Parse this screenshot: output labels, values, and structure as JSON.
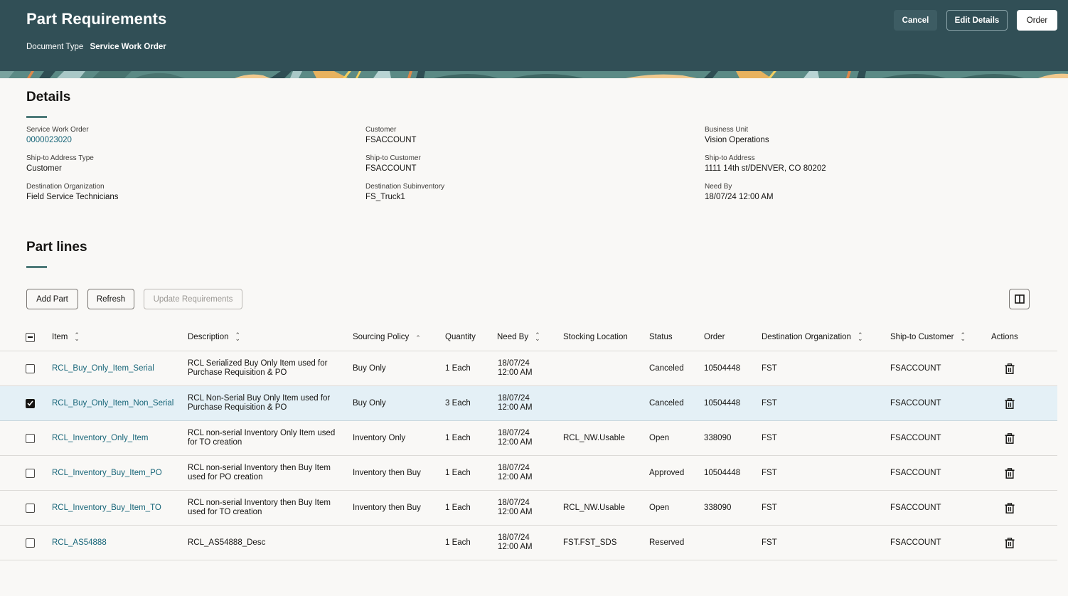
{
  "header": {
    "title": "Part Requirements",
    "document_type_label": "Document Type",
    "document_type_value": "Service Work Order",
    "buttons": {
      "cancel": "Cancel",
      "edit_details": "Edit Details",
      "order": "Order"
    }
  },
  "details": {
    "title": "Details",
    "fields": {
      "service_work_order": {
        "label": "Service Work Order",
        "value": "0000023020"
      },
      "customer": {
        "label": "Customer",
        "value": "FSACCOUNT"
      },
      "business_unit": {
        "label": "Business Unit",
        "value": "Vision Operations"
      },
      "ship_to_address_type": {
        "label": "Ship-to Address Type",
        "value": "Customer"
      },
      "ship_to_customer": {
        "label": "Ship-to Customer",
        "value": "FSACCOUNT"
      },
      "ship_to_address": {
        "label": "Ship-to Address",
        "value": "1111 14th st/DENVER, CO 80202"
      },
      "destination_organization": {
        "label": "Destination Organization",
        "value": "Field Service Technicians"
      },
      "destination_subinventory": {
        "label": "Destination Subinventory",
        "value": "FS_Truck1"
      },
      "need_by": {
        "label": "Need By",
        "value": "18/07/24 12:00 AM"
      }
    }
  },
  "part_lines": {
    "title": "Part lines",
    "toolbar": {
      "add_part": "Add Part",
      "refresh": "Refresh",
      "update_requirements": "Update Requirements"
    },
    "columns": {
      "item": "Item",
      "description": "Description",
      "sourcing_policy": "Sourcing Policy",
      "quantity": "Quantity",
      "need_by": "Need By",
      "stocking_location": "Stocking Location",
      "status": "Status",
      "order": "Order",
      "destination_organization": "Destination Organization",
      "ship_to_customer": "Ship-to Customer",
      "actions": "Actions"
    },
    "rows": [
      {
        "checked": false,
        "item": "RCL_Buy_Only_Item_Serial",
        "description_1": "RCL Serialized Buy Only Item used for",
        "description_2": "Purchase Requisition & PO",
        "sourcing_policy": "Buy Only",
        "quantity": "1 Each",
        "need_by_date": "18/07/24",
        "need_by_time": "12:00 AM",
        "stocking_location": "",
        "status": "Canceled",
        "order": "10504448",
        "destination_organization": "FST",
        "ship_to_customer": "FSACCOUNT"
      },
      {
        "checked": true,
        "item": "RCL_Buy_Only_Item_Non_Serial",
        "description_1": "RCL Non-Serial Buy Only Item used for",
        "description_2": "Purchase Requisition & PO",
        "sourcing_policy": "Buy Only",
        "quantity": "3 Each",
        "need_by_date": "18/07/24",
        "need_by_time": "12:00 AM",
        "stocking_location": "",
        "status": "Canceled",
        "order": "10504448",
        "destination_organization": "FST",
        "ship_to_customer": "FSACCOUNT"
      },
      {
        "checked": false,
        "item": "RCL_Inventory_Only_Item",
        "description_1": "RCL non-serial Inventory Only Item used",
        "description_2": "for TO creation",
        "sourcing_policy": "Inventory Only",
        "quantity": "1 Each",
        "need_by_date": "18/07/24",
        "need_by_time": "12:00 AM",
        "stocking_location": "RCL_NW.Usable",
        "status": "Open",
        "order": "338090",
        "destination_organization": "FST",
        "ship_to_customer": "FSACCOUNT"
      },
      {
        "checked": false,
        "item": "RCL_Inventory_Buy_Item_PO",
        "description_1": "RCL non-serial Inventory then Buy Item",
        "description_2": "used for PO creation",
        "sourcing_policy": "Inventory then Buy",
        "quantity": "1 Each",
        "need_by_date": "18/07/24",
        "need_by_time": "12:00 AM",
        "stocking_location": "",
        "status": "Approved",
        "order": "10504448",
        "destination_organization": "FST",
        "ship_to_customer": "FSACCOUNT"
      },
      {
        "checked": false,
        "item": "RCL_Inventory_Buy_Item_TO",
        "description_1": "RCL non-serial Inventory then Buy Item",
        "description_2": "used for TO creation",
        "sourcing_policy": "Inventory then Buy",
        "quantity": "1 Each",
        "need_by_date": "18/07/24",
        "need_by_time": "12:00 AM",
        "stocking_location": "RCL_NW.Usable",
        "status": "Open",
        "order": "338090",
        "destination_organization": "FST",
        "ship_to_customer": "FSACCOUNT"
      },
      {
        "checked": false,
        "item": "RCL_AS54888",
        "description_1": "RCL_AS54888_Desc",
        "description_2": "",
        "sourcing_policy": "",
        "quantity": "1 Each",
        "need_by_date": "18/07/24",
        "need_by_time": "12:00 AM",
        "stocking_location": "FST.FST_SDS",
        "status": "Reserved",
        "order": "",
        "destination_organization": "FST",
        "ship_to_customer": "FSACCOUNT"
      }
    ]
  },
  "colors": {
    "header_bg": "#314f56",
    "link": "#176578",
    "selected_row": "#e4f0f6",
    "accent_rule": "#4e7a79"
  }
}
